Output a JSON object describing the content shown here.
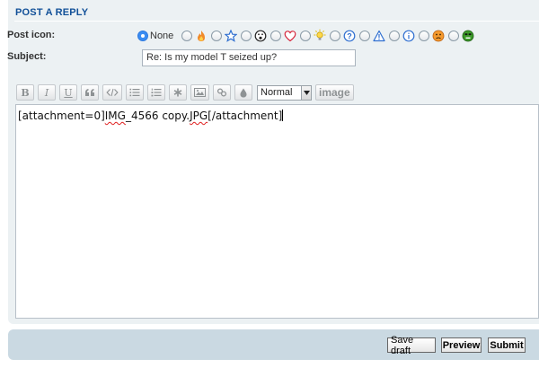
{
  "panel": {
    "title": "POST A REPLY"
  },
  "post_icon": {
    "label": "Post icon:",
    "none_label": "None",
    "selected": "None",
    "options": [
      "none",
      "fire-icon",
      "star-icon",
      "surprised-face-icon",
      "heart-icon",
      "lightbulb-icon",
      "question-icon",
      "warning-icon",
      "info-icon",
      "sad-face-icon",
      "angry-face-icon"
    ]
  },
  "subject": {
    "label": "Subject:",
    "value": "Re: Is my model T seized up?"
  },
  "toolbar": {
    "bold_label": "B",
    "italic_label": "I",
    "underline_label": "U",
    "size_selected": "Normal",
    "image_label": "image"
  },
  "editor": {
    "before": "[attachment=0]",
    "misspelled_1": "IMG",
    "mid": "_4566 copy.",
    "misspelled_2": "JPG",
    "after": "[/attachment]"
  },
  "footer": {
    "save_draft_label": "Save draft",
    "preview_label": "Preview",
    "submit_label": "Submit"
  },
  "colors": {
    "panel_bg": "#ecf1f3",
    "title_blue": "#115098",
    "footer_bg": "#cad9e2"
  }
}
